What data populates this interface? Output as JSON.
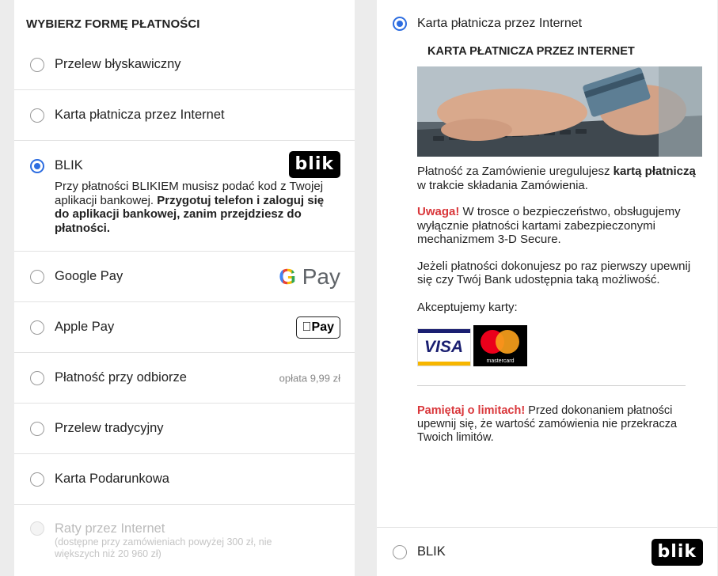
{
  "left": {
    "title": "WYBIERZ FORMĘ PŁATNOŚCI",
    "methods": [
      {
        "label": "Przelew błyskawiczny",
        "selected": false
      },
      {
        "label": "Karta płatnicza przez Internet",
        "selected": false
      },
      {
        "label": "BLIK",
        "selected": true,
        "logo": "blik"
      },
      {
        "label": "Google Pay",
        "selected": false,
        "logo": "G Pay"
      },
      {
        "label": "Apple Pay",
        "selected": false,
        "logo": "Pay"
      },
      {
        "label": "Płatność przy odbiorze",
        "selected": false,
        "fee": "opłata 9,99 zł"
      },
      {
        "label": "Przelew tradycyjny",
        "selected": false
      },
      {
        "label": "Karta Podarunkowa",
        "selected": false
      },
      {
        "label": "Raty przez Internet",
        "selected": false,
        "disabled": true,
        "sub_line1": "(dostępne przy zamówieniach powyżej 300 zł, nie",
        "sub_line2": "większych niż 20 960 zł)"
      }
    ],
    "blik_desc_normal": "Przy płatności BLIKIEM musisz podać kod z Twojej aplikacji bankowej. ",
    "blik_desc_bold": "Przygotuj telefon i zaloguj się do aplikacji bankowej, zanim przejdziesz do płatności.",
    "blik_logo_text": "blik",
    "gpay_g": "G",
    "gpay_rest": " Pay",
    "applepay_text": "Pay"
  },
  "right": {
    "selected_label": "Karta płatnicza przez Internet",
    "section_title": "KARTA PŁATNICZA PRZEZ INTERNET",
    "p1_a": "Płatność za Zamówienie uregulujesz ",
    "p1_b": "kartą płatniczą",
    "p1_c": " w trakcie składania Zamówienia.",
    "warn_label": "Uwaga!",
    "warn_text": " W trosce o bezpieczeństwo, obsługujemy wyłącznie płatności kartami zabezpieczonymi mechanizmem 3-D Secure.",
    "p3": "Jeżeli płatności dokonujesz po raz pierwszy upewnij się czy Twój Bank udostępnia taką możliwość.",
    "accept": "Akceptujemy karty:",
    "visa_text": "VISA",
    "mc_text": "mastercard",
    "limit_label": "Pamiętaj o limitach!",
    "limit_text": " Przed dokonaniem płatności upewnij się, że wartość zamówienia nie przekracza Twoich limitów.",
    "bottom_label": "BLIK",
    "bottom_logo": "blik"
  },
  "colors": {
    "accent": "#2d6de0",
    "warning": "#d9363a"
  }
}
